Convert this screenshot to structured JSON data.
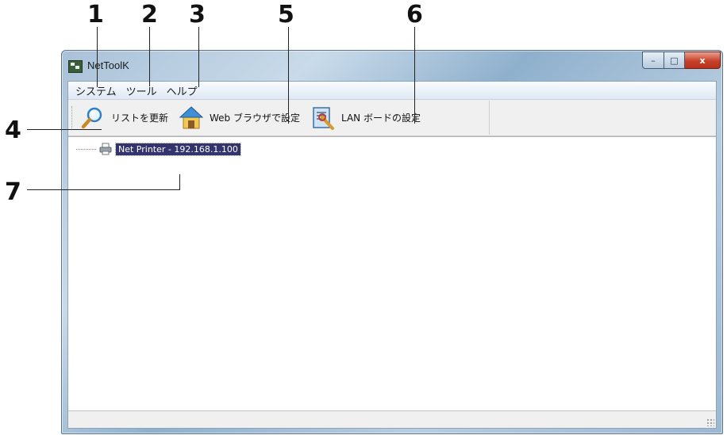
{
  "callouts": [
    "1",
    "2",
    "3",
    "4",
    "5",
    "6",
    "7"
  ],
  "window": {
    "title": "NetToolK",
    "controls": {
      "minimize": "–",
      "maximize": "□",
      "close": "x"
    }
  },
  "menu": {
    "items": [
      "システム",
      "ツール",
      "ヘルプ"
    ]
  },
  "toolbar": {
    "buttons": [
      {
        "label": "リストを更新",
        "icon": "magnifier-icon"
      },
      {
        "label": "Web ブラウザで設定",
        "icon": "house-icon"
      },
      {
        "label": "LAN ボードの設定",
        "icon": "settings-tool-icon"
      }
    ]
  },
  "tree": {
    "items": [
      {
        "label": "Net Printer - 192.168.1.100",
        "icon": "printer-icon",
        "selected": true
      }
    ]
  },
  "colors": {
    "selection": "#33336e",
    "close_button": "#c7412a"
  }
}
